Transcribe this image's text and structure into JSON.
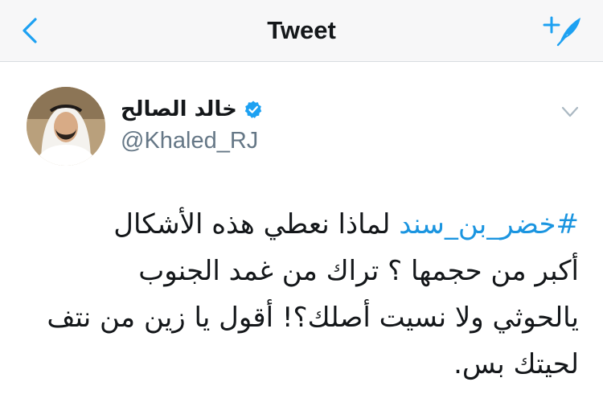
{
  "header": {
    "title": "Tweet",
    "back_icon": "chevron-left-icon",
    "compose_icon": "compose-tweet-icon",
    "accent_color": "#1da1f2"
  },
  "tweet": {
    "author": {
      "display_name": "خالد الصالح",
      "handle": "@Khaled_RJ",
      "verified": true,
      "avatar_icon": "user-avatar"
    },
    "menu_icon": "chevron-down-icon",
    "hashtag": "#خضر_بن_سند",
    "line1_text": " لماذا نعطي هذه الأشكال",
    "line2": "أكبر من حجمها ؟ تراك من غمد الجنوب",
    "line3": "يالحوثي ولا نسيت أصلك؟! أقول يا زين من نتف",
    "line4": "لحيتك بس.",
    "hashtag_color": "#1b95e0",
    "text_color": "#14171a"
  }
}
